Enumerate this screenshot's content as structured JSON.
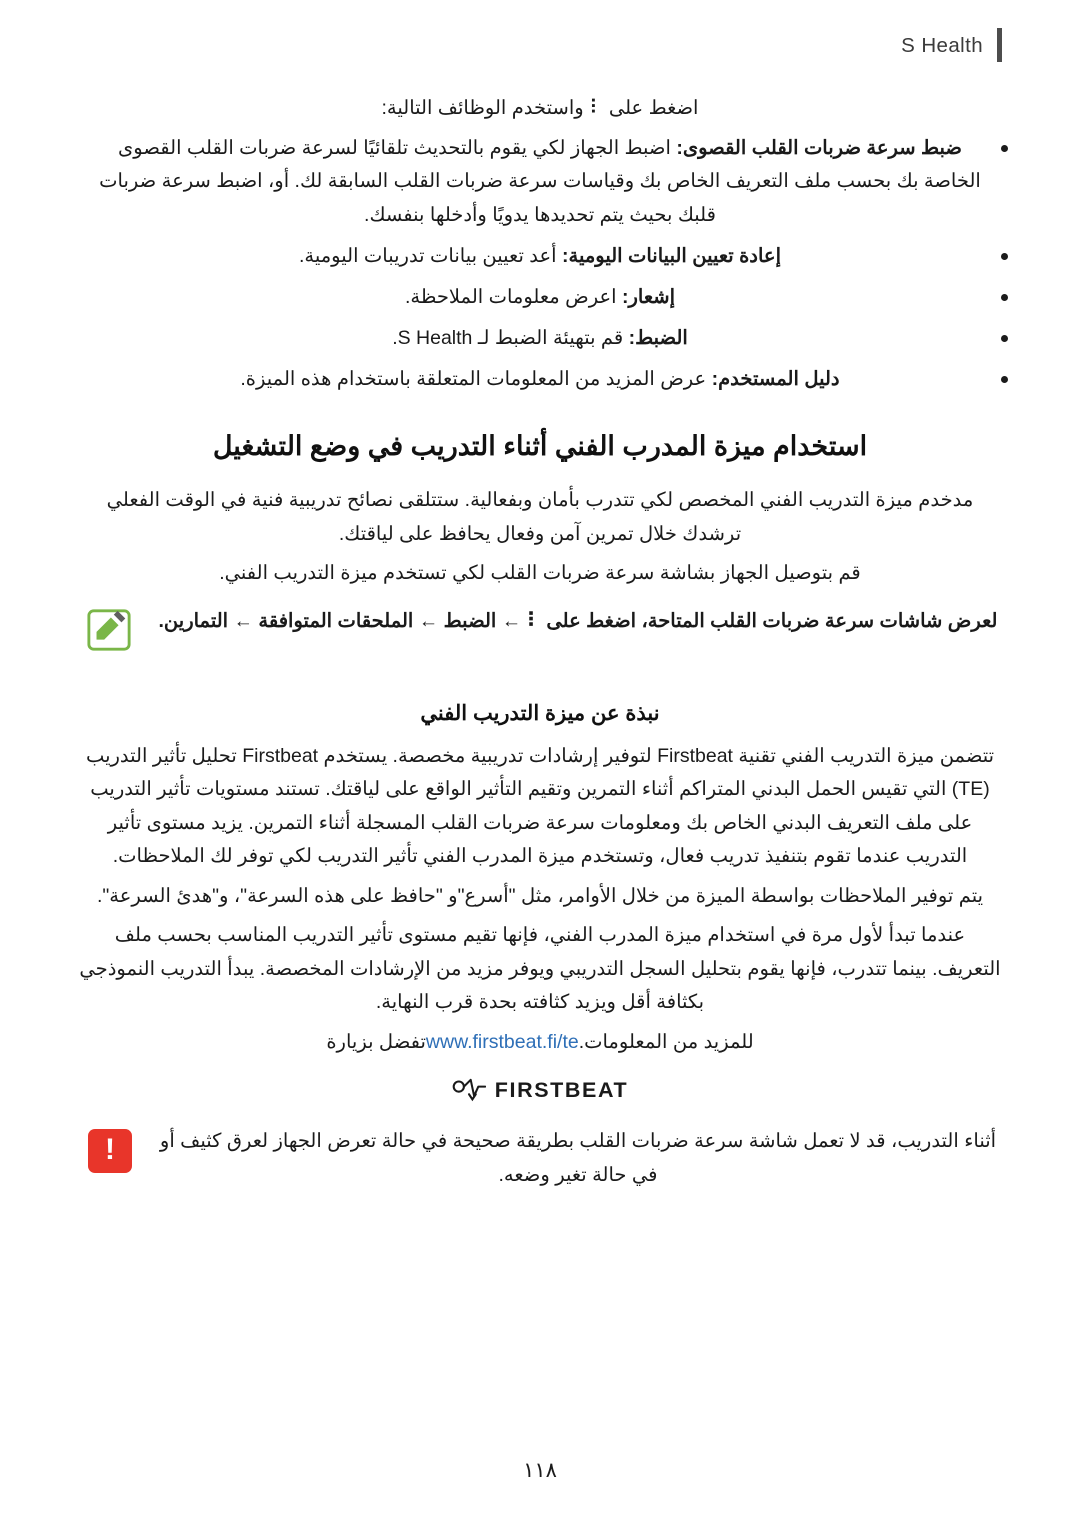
{
  "header": {
    "title": "S Health"
  },
  "intro": {
    "line": "اضغط على ⠇ واستخدم الوظائف التالية:"
  },
  "bullets": [
    {
      "bold": "ضبط سرعة ضربات القلب القصوى:",
      "text": " اضبط الجهاز لكي يقوم بالتحديث تلقائيًا لسرعة ضربات القلب القصوى الخاصة بك بحسب ملف التعريف الخاص بك وقياسات سرعة ضربات القلب السابقة لك. أو، اضبط سرعة ضربات قلبك بحيث يتم تحديدها يدويًا وأدخلها بنفسك."
    },
    {
      "bold": "إعادة تعيين البيانات اليومية:",
      "text": " أعد تعيين بيانات تدريبات اليومية."
    },
    {
      "bold": "إشعار:",
      "text": " اعرض معلومات الملاحظة."
    },
    {
      "bold": "الضبط:",
      "text": " قم بتهيئة الضبط لـ S Health."
    },
    {
      "bold": "دليل المستخدم:",
      "text": " عرض المزيد من المعلومات المتعلقة باستخدام هذه الميزة."
    }
  ],
  "section": {
    "title": "استخدام ميزة المدرب الفني أثناء التدريب في وضع التشغيل",
    "p1": "مدخدم ميزة التدريب الفني المخصص لكي تتدرب بأمان وبفعالية. ستتلقى نصائح تدريبية فنية في الوقت الفعلي ترشدك خلال تمرين آمن وفعال يحافظ على لياقتك.",
    "p2": "قم بتوصيل الجهاز بشاشة سرعة ضربات القلب لكي تستخدم ميزة التدريب الفني.",
    "note": {
      "text": "لعرض شاشات سرعة ضربات القلب المتاحة، اضغط على ⠇ ← الضبط ← الملحقات المتوافقة ← التمارين.",
      "bold_parts": [
        "الضبط",
        "الملحقات المتوافقة",
        "التمارين"
      ]
    },
    "subsection_title": "نبذة عن ميزة التدريب الفني",
    "p3": "تتضمن ميزة التدريب الفني تقنية Firstbeat لتوفير إرشادات تدريبية مخصصة. يستخدم Firstbeat تحليل تأثير التدريب (TE) التي تقيس الحمل البدني المتراكم أثناء التمرين وتقيم التأثير الواقع على لياقتك. تستند مستويات تأثير التدريب على ملف التعريف البدني الخاص بك ومعلومات سرعة ضربات القلب المسجلة أثناء التمرين. يزيد مستوى تأثير التدريب عندما تقوم بتنفيذ تدريب فعال، وتستخدم ميزة المدرب الفني تأثير التدريب لكي توفر لك الملاحظات.",
    "p4": "يتم توفير الملاحظات بواسطة الميزة من خلال الأوامر، مثل \"أسرع\"و \"حافظ على هذه السرعة\"، و\"هدئ السرعة\".",
    "p5": "عندما تبدأ لأول مرة في استخدام ميزة المدرب الفني، فإنها تقيم مستوى تأثير التدريب المناسب بحسب ملف التعريف. بينما تتدرب، فإنها يقوم بتحليل السجل التدريبي ويوفر مزيد من الإرشادات المخصصة. يبدأ التدريب النموذجي بكثافة أقل ويزيد كثافته بحدة قرب النهاية.",
    "link_text_before": "تفضل بزيارة ",
    "link_url_text": "www.firstbeat.fi/te",
    "link_text_after": " للمزيد من المعلومات."
  },
  "firstbeat_logo": {
    "wordmark": "FIRSTBEAT"
  },
  "warning": {
    "text": "أثناء التدريب، قد لا تعمل شاشة سرعة ضربات القلب بطريقة صحيحة في حالة تعرض الجهاز لعرق كثيف أو في حالة تغير وضعه."
  },
  "footer": {
    "page_number": "١١٨"
  }
}
